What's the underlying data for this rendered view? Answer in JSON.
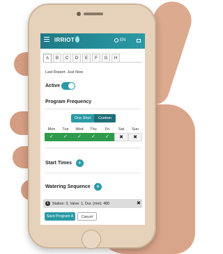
{
  "header": {
    "brand": "IRRIOT",
    "language": "EN",
    "menu_icon": "hamburger-menu-icon",
    "globe_icon": "globe-icon",
    "exit_icon": "exit-icon",
    "color": "#2a9aa6"
  },
  "tabs": [
    "A",
    "B",
    "C",
    "D",
    "E",
    "F",
    "G",
    "H"
  ],
  "active_tab": "A",
  "last_report": "Last Report: Just Now",
  "active": {
    "label": "Active",
    "on": true
  },
  "program_frequency": {
    "title": "Program Frequency",
    "modes": [
      "One Shot",
      "Custom"
    ],
    "selected": "Custom"
  },
  "days": [
    {
      "name": "Mon",
      "mark": "✓",
      "on": true
    },
    {
      "name": "Tue",
      "mark": "✓",
      "on": true
    },
    {
      "name": "Wed",
      "mark": "✓",
      "on": true
    },
    {
      "name": "Thu",
      "mark": "✓",
      "on": true
    },
    {
      "name": "Fri",
      "mark": "✓",
      "on": true
    },
    {
      "name": "Sat",
      "mark": "✖",
      "on": false
    },
    {
      "name": "Sun",
      "mark": "✖",
      "on": false
    }
  ],
  "start_times": {
    "title": "Start Times",
    "add": "+"
  },
  "watering_sequence": {
    "title": "Watering Sequence",
    "add": "+"
  },
  "alert": {
    "text": "Station: 3, Valve: 1, Dur. (min): 480",
    "close": "✖",
    "info": "i"
  },
  "buttons": {
    "save": "Save Program A",
    "cancel": "Cancel"
  }
}
